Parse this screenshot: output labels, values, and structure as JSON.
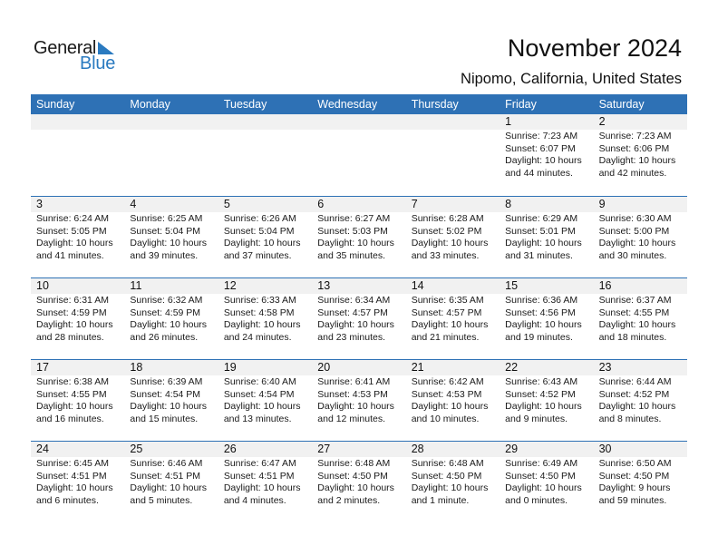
{
  "logo": {
    "line1": "General",
    "line2": "Blue",
    "accent_color": "#2a7ac0"
  },
  "header": {
    "title": "November 2024",
    "location": "Nipomo, California, United States"
  },
  "colors": {
    "header_bg": "#2e71b5",
    "daynum_bg": "#f1f1f1"
  },
  "weekdays": [
    "Sunday",
    "Monday",
    "Tuesday",
    "Wednesday",
    "Thursday",
    "Friday",
    "Saturday"
  ],
  "weeks": [
    [
      null,
      null,
      null,
      null,
      null,
      {
        "day": "1",
        "sunrise": "Sunrise: 7:23 AM",
        "sunset": "Sunset: 6:07 PM",
        "daylight1": "Daylight: 10 hours",
        "daylight2": "and 44 minutes."
      },
      {
        "day": "2",
        "sunrise": "Sunrise: 7:23 AM",
        "sunset": "Sunset: 6:06 PM",
        "daylight1": "Daylight: 10 hours",
        "daylight2": "and 42 minutes."
      }
    ],
    [
      {
        "day": "3",
        "sunrise": "Sunrise: 6:24 AM",
        "sunset": "Sunset: 5:05 PM",
        "daylight1": "Daylight: 10 hours",
        "daylight2": "and 41 minutes."
      },
      {
        "day": "4",
        "sunrise": "Sunrise: 6:25 AM",
        "sunset": "Sunset: 5:04 PM",
        "daylight1": "Daylight: 10 hours",
        "daylight2": "and 39 minutes."
      },
      {
        "day": "5",
        "sunrise": "Sunrise: 6:26 AM",
        "sunset": "Sunset: 5:04 PM",
        "daylight1": "Daylight: 10 hours",
        "daylight2": "and 37 minutes."
      },
      {
        "day": "6",
        "sunrise": "Sunrise: 6:27 AM",
        "sunset": "Sunset: 5:03 PM",
        "daylight1": "Daylight: 10 hours",
        "daylight2": "and 35 minutes."
      },
      {
        "day": "7",
        "sunrise": "Sunrise: 6:28 AM",
        "sunset": "Sunset: 5:02 PM",
        "daylight1": "Daylight: 10 hours",
        "daylight2": "and 33 minutes."
      },
      {
        "day": "8",
        "sunrise": "Sunrise: 6:29 AM",
        "sunset": "Sunset: 5:01 PM",
        "daylight1": "Daylight: 10 hours",
        "daylight2": "and 31 minutes."
      },
      {
        "day": "9",
        "sunrise": "Sunrise: 6:30 AM",
        "sunset": "Sunset: 5:00 PM",
        "daylight1": "Daylight: 10 hours",
        "daylight2": "and 30 minutes."
      }
    ],
    [
      {
        "day": "10",
        "sunrise": "Sunrise: 6:31 AM",
        "sunset": "Sunset: 4:59 PM",
        "daylight1": "Daylight: 10 hours",
        "daylight2": "and 28 minutes."
      },
      {
        "day": "11",
        "sunrise": "Sunrise: 6:32 AM",
        "sunset": "Sunset: 4:59 PM",
        "daylight1": "Daylight: 10 hours",
        "daylight2": "and 26 minutes."
      },
      {
        "day": "12",
        "sunrise": "Sunrise: 6:33 AM",
        "sunset": "Sunset: 4:58 PM",
        "daylight1": "Daylight: 10 hours",
        "daylight2": "and 24 minutes."
      },
      {
        "day": "13",
        "sunrise": "Sunrise: 6:34 AM",
        "sunset": "Sunset: 4:57 PM",
        "daylight1": "Daylight: 10 hours",
        "daylight2": "and 23 minutes."
      },
      {
        "day": "14",
        "sunrise": "Sunrise: 6:35 AM",
        "sunset": "Sunset: 4:57 PM",
        "daylight1": "Daylight: 10 hours",
        "daylight2": "and 21 minutes."
      },
      {
        "day": "15",
        "sunrise": "Sunrise: 6:36 AM",
        "sunset": "Sunset: 4:56 PM",
        "daylight1": "Daylight: 10 hours",
        "daylight2": "and 19 minutes."
      },
      {
        "day": "16",
        "sunrise": "Sunrise: 6:37 AM",
        "sunset": "Sunset: 4:55 PM",
        "daylight1": "Daylight: 10 hours",
        "daylight2": "and 18 minutes."
      }
    ],
    [
      {
        "day": "17",
        "sunrise": "Sunrise: 6:38 AM",
        "sunset": "Sunset: 4:55 PM",
        "daylight1": "Daylight: 10 hours",
        "daylight2": "and 16 minutes."
      },
      {
        "day": "18",
        "sunrise": "Sunrise: 6:39 AM",
        "sunset": "Sunset: 4:54 PM",
        "daylight1": "Daylight: 10 hours",
        "daylight2": "and 15 minutes."
      },
      {
        "day": "19",
        "sunrise": "Sunrise: 6:40 AM",
        "sunset": "Sunset: 4:54 PM",
        "daylight1": "Daylight: 10 hours",
        "daylight2": "and 13 minutes."
      },
      {
        "day": "20",
        "sunrise": "Sunrise: 6:41 AM",
        "sunset": "Sunset: 4:53 PM",
        "daylight1": "Daylight: 10 hours",
        "daylight2": "and 12 minutes."
      },
      {
        "day": "21",
        "sunrise": "Sunrise: 6:42 AM",
        "sunset": "Sunset: 4:53 PM",
        "daylight1": "Daylight: 10 hours",
        "daylight2": "and 10 minutes."
      },
      {
        "day": "22",
        "sunrise": "Sunrise: 6:43 AM",
        "sunset": "Sunset: 4:52 PM",
        "daylight1": "Daylight: 10 hours",
        "daylight2": "and 9 minutes."
      },
      {
        "day": "23",
        "sunrise": "Sunrise: 6:44 AM",
        "sunset": "Sunset: 4:52 PM",
        "daylight1": "Daylight: 10 hours",
        "daylight2": "and 8 minutes."
      }
    ],
    [
      {
        "day": "24",
        "sunrise": "Sunrise: 6:45 AM",
        "sunset": "Sunset: 4:51 PM",
        "daylight1": "Daylight: 10 hours",
        "daylight2": "and 6 minutes."
      },
      {
        "day": "25",
        "sunrise": "Sunrise: 6:46 AM",
        "sunset": "Sunset: 4:51 PM",
        "daylight1": "Daylight: 10 hours",
        "daylight2": "and 5 minutes."
      },
      {
        "day": "26",
        "sunrise": "Sunrise: 6:47 AM",
        "sunset": "Sunset: 4:51 PM",
        "daylight1": "Daylight: 10 hours",
        "daylight2": "and 4 minutes."
      },
      {
        "day": "27",
        "sunrise": "Sunrise: 6:48 AM",
        "sunset": "Sunset: 4:50 PM",
        "daylight1": "Daylight: 10 hours",
        "daylight2": "and 2 minutes."
      },
      {
        "day": "28",
        "sunrise": "Sunrise: 6:48 AM",
        "sunset": "Sunset: 4:50 PM",
        "daylight1": "Daylight: 10 hours",
        "daylight2": "and 1 minute."
      },
      {
        "day": "29",
        "sunrise": "Sunrise: 6:49 AM",
        "sunset": "Sunset: 4:50 PM",
        "daylight1": "Daylight: 10 hours",
        "daylight2": "and 0 minutes."
      },
      {
        "day": "30",
        "sunrise": "Sunrise: 6:50 AM",
        "sunset": "Sunset: 4:50 PM",
        "daylight1": "Daylight: 9 hours",
        "daylight2": "and 59 minutes."
      }
    ]
  ]
}
